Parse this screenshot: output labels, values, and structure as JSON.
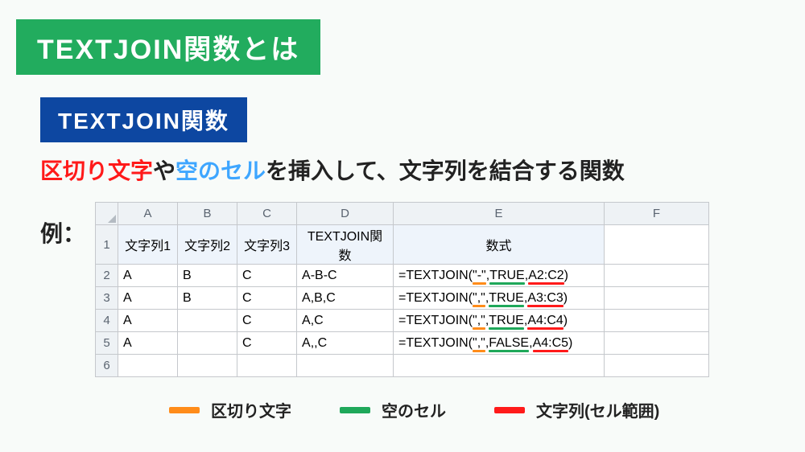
{
  "title": "TEXTJOIN関数とは",
  "subtitle": "TEXTJOIN関数",
  "desc": {
    "t1": "区切り文字",
    "t2": "や",
    "t3": "空のセル",
    "t4": "を挿入して、文字列を結合する関数"
  },
  "example_label": "例：",
  "cols": [
    "A",
    "B",
    "C",
    "D",
    "E",
    "F"
  ],
  "headers": {
    "a": "文字列1",
    "b": "文字列2",
    "c": "文字列3",
    "d": "TEXTJOIN関数",
    "e": "数式"
  },
  "rows": [
    {
      "n": "2",
      "a": "A",
      "b": "B",
      "c": "C",
      "d": "A-B-C",
      "f": {
        "pre": "=TEXTJOIN(",
        "arg1": "\"-\"",
        "c1": ",",
        "arg2": "TRUE",
        "c2": ",",
        "arg3": "A2:C2",
        "post": ")"
      }
    },
    {
      "n": "3",
      "a": "A",
      "b": "B",
      "c": "C",
      "d": "A,B,C",
      "f": {
        "pre": "=TEXTJOIN(",
        "arg1": "\",\"",
        "c1": ",",
        "arg2": "TRUE",
        "c2": ",",
        "arg3": "A3:C3",
        "post": ")"
      }
    },
    {
      "n": "4",
      "a": "A",
      "b": "",
      "c": "C",
      "d": "A,C",
      "f": {
        "pre": "=TEXTJOIN(",
        "arg1": "\",\"",
        "c1": ",",
        "arg2": "TRUE",
        "c2": ",",
        "arg3": "A4:C4",
        "post": ")"
      }
    },
    {
      "n": "5",
      "a": "A",
      "b": "",
      "c": "C",
      "d": "A,,C",
      "f": {
        "pre": "=TEXTJOIN(",
        "arg1": "\",\"",
        "c1": ",",
        "arg2": "FALSE",
        "c2": ",",
        "arg3": "A4:C5",
        "post": ")"
      }
    }
  ],
  "row1": "1",
  "row6": "6",
  "legend": {
    "delim": "区切り文字",
    "empty": "空のセル",
    "range": "文字列(セル範囲)"
  },
  "chart_data": {
    "type": "table",
    "headers": [
      "文字列1",
      "文字列2",
      "文字列3",
      "TEXTJOIN関数",
      "数式"
    ],
    "rows": [
      [
        "A",
        "B",
        "C",
        "A-B-C",
        "=TEXTJOIN(\"-\",TRUE,A2:C2)"
      ],
      [
        "A",
        "B",
        "C",
        "A,B,C",
        "=TEXTJOIN(\",\",TRUE,A3:C3)"
      ],
      [
        "A",
        "",
        "C",
        "A,C",
        "=TEXTJOIN(\",\",TRUE,A4:C4)"
      ],
      [
        "A",
        "",
        "C",
        "A,,C",
        "=TEXTJOIN(\",\",FALSE,A4:C5)"
      ]
    ]
  }
}
